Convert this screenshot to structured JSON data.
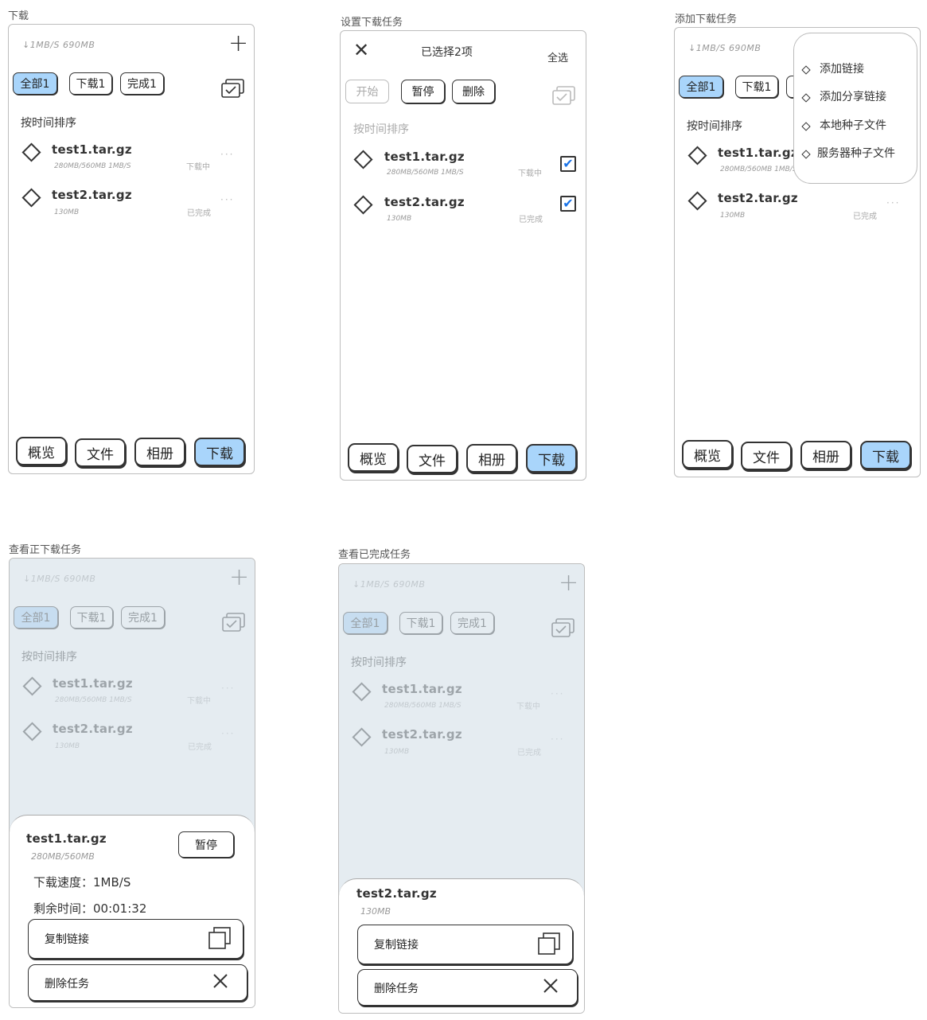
{
  "captions": {
    "s1": "下载",
    "s2": "设置下载任务",
    "s3": "添加下载任务",
    "s4": "查看正下载任务",
    "s5": "查看已完成任务"
  },
  "header": {
    "speed_info": "↓1MB/S  690MB",
    "add_symbol": "+"
  },
  "filters": {
    "all": "全部1",
    "downloading": "下载1",
    "done": "完成1"
  },
  "sort_label": "按时间排序",
  "files": [
    {
      "name": "test1.tar.gz",
      "meta": "280MB/560MB  1MB/S",
      "status": "下载中",
      "more": "···"
    },
    {
      "name": "test2.tar.gz",
      "meta": "130MB",
      "status": "已完成",
      "more": "···"
    }
  ],
  "nav": {
    "overview": "概览",
    "files": "文件",
    "album": "相册",
    "download": "下载"
  },
  "select_mode": {
    "title": "已选择2项",
    "select_all": "全选",
    "close_symbol": "✕",
    "start": "开始",
    "pause": "暂停",
    "delete": "删除",
    "check_symbol": "✔"
  },
  "add_menu": {
    "items": [
      "添加链接",
      "添加分享链接",
      "本地种子文件",
      "服务器种子文件"
    ]
  },
  "downloading_sheet": {
    "name": "test1.tar.gz",
    "size": "280MB/560MB",
    "pause": "暂停",
    "speed": "下载速度：1MB/S",
    "remaining": "剩余时间：00:01:32",
    "copy_link": "复制链接",
    "delete_task": "删除任务"
  },
  "done_sheet": {
    "name": "test2.tar.gz",
    "size": "130MB",
    "copy_link": "复制链接",
    "delete_task": "删除任务"
  }
}
